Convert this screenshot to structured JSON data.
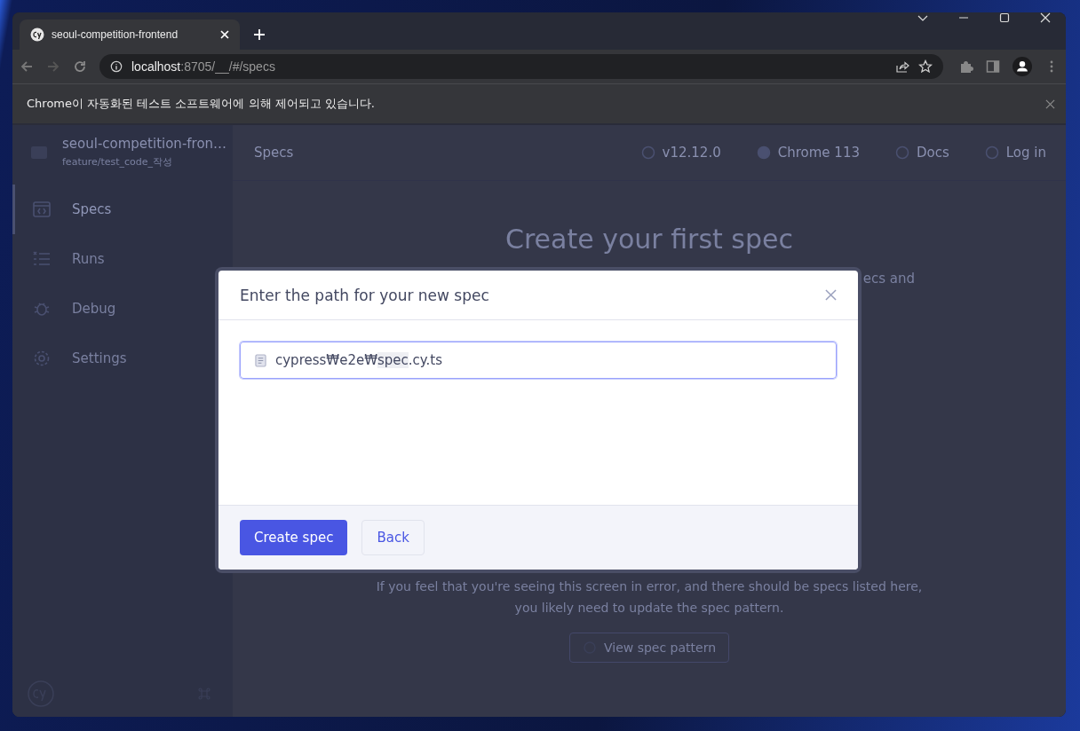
{
  "browser": {
    "tab": {
      "title": "seoul-competition-frontend"
    },
    "url": {
      "host": "localhost",
      "path": ":8705/__/#/specs"
    },
    "infobar": {
      "message": "Chrome이 자동화된 테스트 소프트웨어에 의해 제어되고 있습니다."
    }
  },
  "sidebar": {
    "project": "seoul-competition-fron…",
    "branch": "feature/test_code_작성",
    "items": [
      {
        "label": "Specs",
        "selected": true
      },
      {
        "label": "Runs",
        "selected": false
      },
      {
        "label": "Debug",
        "selected": false
      },
      {
        "label": "Settings",
        "selected": false
      }
    ]
  },
  "header": {
    "title": "Specs",
    "links": [
      {
        "label": "v12.12.0"
      },
      {
        "label": "Chrome 113"
      },
      {
        "label": "Docs"
      },
      {
        "label": "Log in"
      }
    ]
  },
  "main": {
    "heading": "Create your first spec",
    "fragment": "ecs and",
    "help": [
      "If you feel that you're seeing this screen in error, and there should be specs listed here,",
      "you likely need to update the spec pattern."
    ],
    "pattern_button": "View spec pattern"
  },
  "dialog": {
    "title": "Enter the path for your new spec",
    "path": {
      "before": "cypress₩e2e₩",
      "highlight": "spec",
      "after": ".cy.ts"
    },
    "buttons": [
      {
        "label": "Create spec",
        "kind": "primary"
      },
      {
        "label": "Back",
        "kind": "secondary"
      }
    ]
  }
}
